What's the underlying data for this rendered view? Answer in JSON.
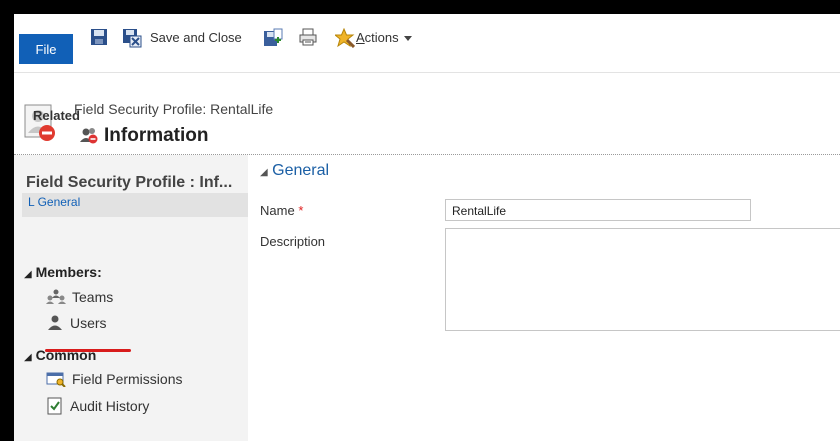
{
  "ribbon": {
    "file_label": "File",
    "save_and_close_label": "Save and Close",
    "actions_label_prefix": "",
    "actions_label_underlined": "A",
    "actions_label_rest": "ctions"
  },
  "header": {
    "subtitle": "Field Security Profile: RentalLife",
    "title": "Information"
  },
  "nav": {
    "title": "Field Security Profile : Inf...",
    "general_link": "L General",
    "related_heading": "Related",
    "members_group": "Members:",
    "teams": "Teams",
    "users": "Users",
    "common_group": "Common",
    "field_permissions": "Field Permissions",
    "audit_history": "Audit History"
  },
  "form": {
    "section_title": "General",
    "name_label": "Name",
    "required_marker": "*",
    "name_value": "RentalLife",
    "description_label": "Description",
    "description_value": ""
  },
  "colors": {
    "file_button": "#1160b7",
    "section_title": "#1b5fa5",
    "highlight_underline": "#d81b1b"
  },
  "icons": [
    "save-icon",
    "save-close-icon",
    "save-new-icon",
    "print-icon",
    "actions-icon",
    "profile-icon",
    "information-icon",
    "teams-icon",
    "users-icon",
    "field-permissions-icon",
    "audit-history-icon"
  ]
}
